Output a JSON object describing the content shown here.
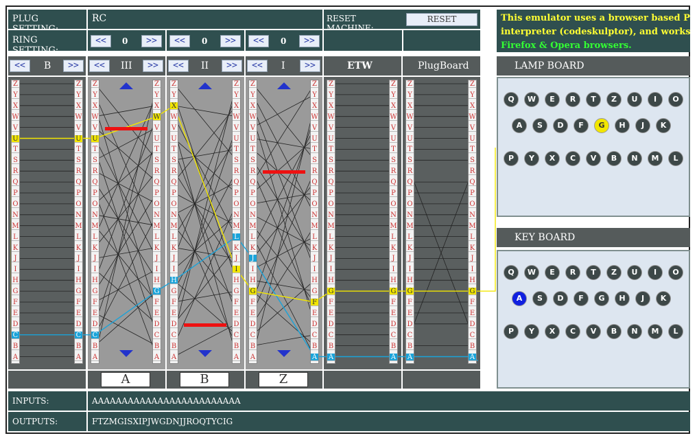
{
  "header": {
    "plug_setting_label": "PLUG SETTING:",
    "plug_setting_value": "RC",
    "reset_label": "RESET MACHINE:",
    "reset_button": "RESET",
    "ring_setting_label": "RING SETTING:",
    "ring_values": [
      "0",
      "0",
      "0"
    ],
    "prev_button": "<<",
    "next_button": ">>"
  },
  "info": {
    "line1": "This emulator uses a browser based Python",
    "line2": "interpreter (codeskulptor), and works with",
    "line3": "Firefox & Opera browsers."
  },
  "rotor_headers": {
    "reflector": "B",
    "rotor_left": "III",
    "rotor_middle": "II",
    "rotor_right": "I",
    "etw": "ETW",
    "plugboard": "PlugBoard"
  },
  "lamp_board": {
    "title": "LAMP BOARD",
    "rows": [
      [
        "Q",
        "W",
        "E",
        "R",
        "T",
        "Z",
        "U",
        "I",
        "O"
      ],
      [
        "A",
        "S",
        "D",
        "F",
        "G",
        "H",
        "J",
        "K"
      ],
      [
        "P",
        "Y",
        "X",
        "C",
        "V",
        "B",
        "N",
        "M",
        "L"
      ]
    ],
    "lit_key": "G"
  },
  "key_board": {
    "title": "KEY BOARD",
    "rows": [
      [
        "Q",
        "W",
        "E",
        "R",
        "T",
        "Z",
        "U",
        "I",
        "O"
      ],
      [
        "A",
        "S",
        "D",
        "F",
        "G",
        "H",
        "J",
        "K"
      ],
      [
        "P",
        "Y",
        "X",
        "C",
        "V",
        "B",
        "N",
        "M",
        "L"
      ]
    ],
    "pressed_key": "A"
  },
  "rotor_positions": [
    "A",
    "B",
    "Z"
  ],
  "alphabet_top_to_bottom": "ZYXWVUTSRQPONMLKJIHGFEDCBA",
  "signal_path": {
    "reflector": {
      "in": "C",
      "out": "U"
    },
    "rotor_left": {
      "in": "G",
      "out": "C",
      "return_in": "U",
      "return_out": "W"
    },
    "rotor_middle": {
      "in": "L",
      "out": "H",
      "return_in": "X",
      "return_out": "I"
    },
    "rotor_right": {
      "in": "A",
      "out": "J",
      "return_in": "G",
      "return_out": "F"
    },
    "etw": {
      "in": "A",
      "out": "A",
      "return_in": "G",
      "return_out": "G"
    },
    "plugboard": {
      "in": "A",
      "out": "A",
      "return_in": "G",
      "return_out": "G"
    }
  },
  "colors": {
    "dark_green": "#2f4f4f",
    "dark_gray": "#555b5b",
    "forward_signal": "#1aa3d9",
    "return_signal": "#f2e600",
    "notch_red": "#ee1111",
    "info_yellow": "#ffff33",
    "info_green": "#33ff33",
    "marker_blue": "#2233cc"
  },
  "io": {
    "inputs_label": "INPUTS:",
    "inputs_value": "AAAAAAAAAAAAAAAAAAAAAAAAA",
    "outputs_label": "OUTPUTS:",
    "outputs_value": "FTZMGISXIPJWGDNJJROQTYCIG"
  }
}
